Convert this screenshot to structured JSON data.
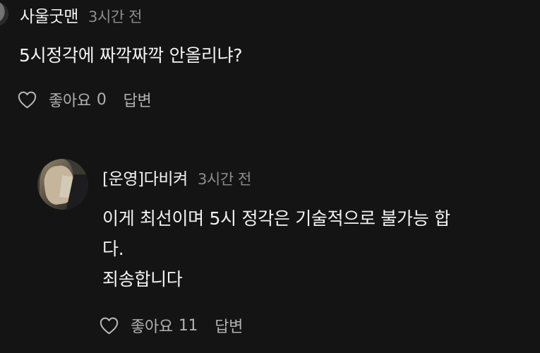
{
  "comments": [
    {
      "author": "사울굿맨",
      "time": "3시간 전",
      "text": "5시정각에 짜깍짜깍 안올리냐?",
      "like_label": "좋아요",
      "like_count": "0",
      "reply_label": "답변",
      "icons": {
        "heart": "heart-outline-icon"
      }
    }
  ],
  "reply": {
    "author": "[운영]다비켜",
    "time": "3시간 전",
    "text_lines": [
      "이게 최선이며 5시 정각은 기술적으로 불가능 합",
      "다.",
      "죄송합니다"
    ],
    "like_label": "좋아요",
    "like_count": "11",
    "reply_label": "답변",
    "icons": {
      "avatar": "avatar-icon",
      "heart": "heart-outline-icon"
    }
  },
  "colors": {
    "background": "#141414",
    "primary_text": "#f3f3f3",
    "secondary_text": "#8d8d8d",
    "action_text": "#b1b1b1"
  }
}
